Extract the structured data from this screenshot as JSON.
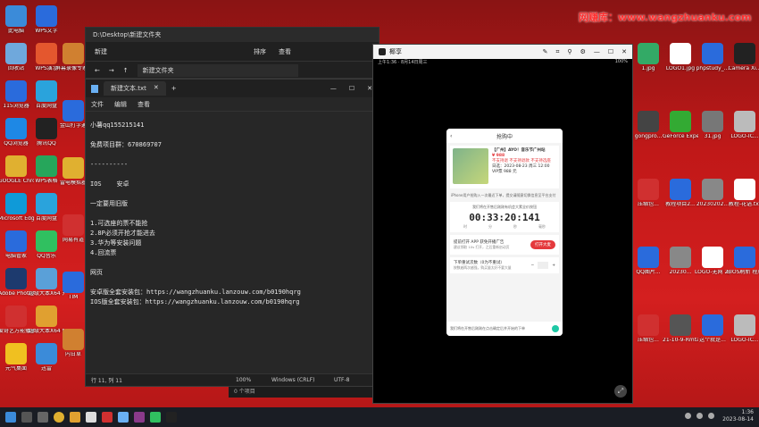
{
  "watermark": "网赚库：www.wangzhuanku.com",
  "desktop_left": [
    {
      "label": "此电脑",
      "color": "#3b8bd9"
    },
    {
      "label": "WPS文字",
      "color": "#2a6bdc"
    },
    {
      "label": "回收站",
      "color": "#6fa8dc"
    },
    {
      "label": "WPS演示",
      "color": "#e4572e"
    },
    {
      "label": "115浏览器",
      "color": "#2a6bdc"
    },
    {
      "label": "百度网盘",
      "color": "#2aa3dc"
    },
    {
      "label": "QQ浏览器",
      "color": "#1e88e5"
    },
    {
      "label": "腾讯QQ",
      "color": "#222222"
    },
    {
      "label": "GOOGLE Chrome",
      "color": "#e0b030"
    },
    {
      "label": "WPS表格",
      "color": "#26a65b"
    },
    {
      "label": "Microsoft Edge",
      "color": "#0f9ad8"
    },
    {
      "label": "百度网盘",
      "color": "#2aa3dc"
    },
    {
      "label": "电脑管家",
      "color": "#2a6bdc"
    },
    {
      "label": "QQ音乐",
      "color": "#30c060"
    },
    {
      "label": "Adobe PhotoA...",
      "color": "#1d3a6e"
    },
    {
      "label": "超级大本X64 开工具.exe",
      "color": "#5aa0d8"
    },
    {
      "label": "爱奇艺万能播放",
      "color": "#d03030"
    },
    {
      "label": "超级大本X64 好包.exe",
      "color": "#e0a030"
    },
    {
      "label": "元气桌面",
      "color": "#f0c020"
    },
    {
      "label": "迅雷",
      "color": "#3b8bd9"
    }
  ],
  "desktop_left_col2": [
    {
      "label": "屏幕录像专家 V2014",
      "color": "#d08030"
    },
    {
      "label": "金山打字通",
      "color": "#2a6bdc"
    },
    {
      "label": "雷电模拟器",
      "color": "#e0b030"
    },
    {
      "label": "网易有道",
      "color": "#d03030"
    },
    {
      "label": "TIM",
      "color": "#2a6bdc"
    },
    {
      "label": "内日草",
      "color": "#d08030"
    }
  ],
  "desktop_right": [
    {
      "label": "1.jpg",
      "color": "#3a6"
    },
    {
      "label": "LOGO1.jpg",
      "color": "#fff"
    },
    {
      "label": "phpstudy_...",
      "color": "#2a6bdc"
    },
    {
      "label": "Camera Xi...",
      "color": "#222"
    },
    {
      "label": "gongpro...",
      "color": "#444"
    },
    {
      "label": "GeForce Experience",
      "color": "#3a3"
    },
    {
      "label": "31.jpg",
      "color": "#777"
    },
    {
      "label": "LOGO-IC...",
      "color": "#bbb"
    },
    {
      "label": "压缩包...",
      "color": "#d03030"
    },
    {
      "label": "教程项目2...",
      "color": "#2a6bdc"
    },
    {
      "label": "20230202...",
      "color": "#888"
    },
    {
      "label": "教程-花语.txt",
      "color": "#fff"
    },
    {
      "label": "QQ图片...",
      "color": "#2a6bdc"
    },
    {
      "label": "20230...",
      "color": "#888"
    },
    {
      "label": "LOGO-无网 2.png",
      "color": "#fff"
    },
    {
      "label": "BIOS刷新 程序.exe",
      "color": "#2a6bdc"
    },
    {
      "label": "压缩包...",
      "color": "#d03030"
    },
    {
      "label": "21-10-9-Rmtal",
      "color": "#555"
    },
    {
      "label": "这个就是...",
      "color": "#2a6bdc"
    },
    {
      "label": "LOGO-IC...",
      "color": "#bbb"
    }
  ],
  "explorer": {
    "path_title": "D:\\Desktop\\新建文件夹",
    "new_label": "新建",
    "sort_label": "排序",
    "view_label": "查看",
    "address": "新建文件夹"
  },
  "notepad": {
    "tab_title": "新建文本.txt",
    "add_tab": "+",
    "menu": [
      "文件",
      "编辑",
      "查看"
    ],
    "lines": [
      "小薯qq155215141",
      "",
      "免费项目群：670869707",
      "",
      "----------",
      "",
      "IOS    安卓",
      "",
      "一定要用旧版",
      "",
      "1.可选座的票不能抢",
      "2.8P必须开抢才能进去",
      "3.华为等安装问题",
      "4.回流票",
      "",
      "网页",
      "",
      "安卓版全套安装包：https://wangzhuanku.lanzouw.com/b0190hqrg",
      "IOS版全套安装包：https://wangzhuanku.lanzouw.com/b0190hqrg"
    ],
    "status": {
      "position": "行 11, 列 11",
      "zoom": "100%",
      "eol": "Windows (CRLF)",
      "encoding": "UTF-8"
    }
  },
  "mini_explorer": "0 个项目",
  "phone": {
    "window_title": "椰享",
    "status_left": "上午1:36 · 8月14日周三",
    "status_right": "100%",
    "header_title": "抢购中",
    "show_title": "【广州】AYO！音乐节广州站",
    "show_price": "¥ 988",
    "show_tags": "不支持退 不支持退款 不支持选座",
    "show_date": "日选：2023-08-23 周三 12:00",
    "show_ticket": "VIP票 988 元",
    "notice": "iPhone用户抢购入一次最近下单，提交请随意切换信息至平台支付",
    "countdown_tip": "我们将在开售后刚刚有机会大素全价按钮",
    "countdown_time": "00:33:20:141",
    "countdown_units": [
      "时",
      "分",
      "秒",
      "毫秒"
    ],
    "promo_text": "提前打开 APP 获免开播广告",
    "promo_sub": "建议领取 10s 打开，之后重新启动页",
    "promo_button": "打开大麦",
    "retry_label": "下单重试次数（0为不重试）",
    "retry_sub": "按数越两次越强，购买量太好不要大量",
    "bottom_tip": "我们将在开售后刚刚在点击确定后并开始的下单"
  },
  "taskbar": {
    "time": "1:36",
    "date": "2023-08-14"
  }
}
